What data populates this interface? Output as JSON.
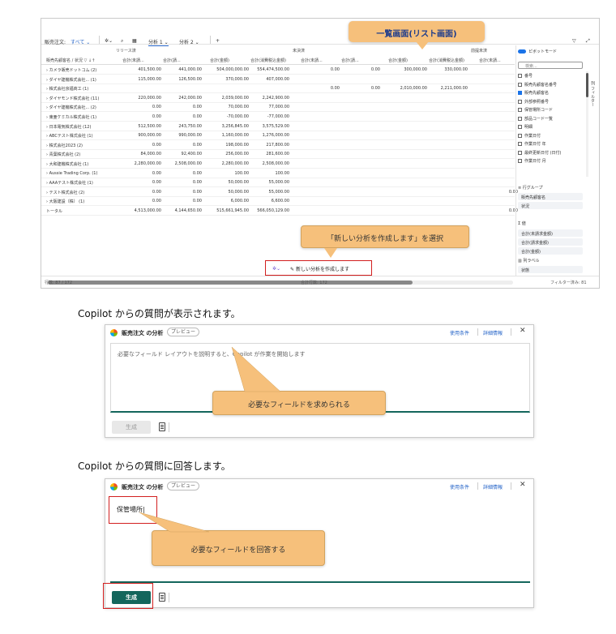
{
  "list_view": {
    "toolbar": {
      "filter_label": "販売注文:",
      "filter_value": "すべて",
      "tab1": "分析 1",
      "tab2": "分析 2",
      "add": "+"
    },
    "badge": "一覧画面(リスト画面)",
    "group_headers": [
      "リリース済",
      "未決済",
      "前提未済"
    ],
    "column_headers": [
      "販売先顧客名 / 状況",
      "合計(未請...",
      "合計(請...",
      "合計(金額)",
      "合計(消費税込金額)",
      "合計(未請...",
      "合計(請...",
      "合計(金額)",
      "合計(消費税込金額)",
      "合計(未請..."
    ],
    "rows": [
      {
        "name": "カメラ販売ドットコム (2)",
        "v": [
          "401,500.00",
          "441,000.00",
          "504,000,000.00",
          "554,474,500.00",
          "0.00",
          "0.00",
          "300,000.00",
          "330,000.00",
          ""
        ]
      },
      {
        "name": "ダイヤ建機株式会社... (1)",
        "v": [
          "115,000.00",
          "126,500.00",
          "370,000.00",
          "407,000.00",
          "",
          "",
          "",
          "",
          ""
        ]
      },
      {
        "name": "株式会社京福商工 (1)",
        "v": [
          "",
          "",
          "",
          "",
          "0.00",
          "0.00",
          "2,010,000.00",
          "2,211,000.00",
          ""
        ]
      },
      {
        "name": "ダイヤモンド株式会社 (11)",
        "v": [
          "220,000.00",
          "242,000.00",
          "2,039,000.00",
          "2,242,900.00",
          "",
          "",
          "",
          "",
          ""
        ]
      },
      {
        "name": "ダイヤ建機株式会社... (2)",
        "v": [
          "0.00",
          "0.00",
          "70,000.00",
          "77,000.00",
          "",
          "",
          "",
          "",
          ""
        ]
      },
      {
        "name": "東亜ケミカル株式会社 (1)",
        "v": [
          "0.00",
          "0.00",
          "-70,000.00",
          "-77,000.00",
          "",
          "",
          "",
          "",
          ""
        ]
      },
      {
        "name": "日本電気株式会社 (12)",
        "v": [
          "512,500.00",
          "243,750.00",
          "3,256,845.00",
          "3,575,529.00",
          "",
          "",
          "",
          "",
          ""
        ]
      },
      {
        "name": "ABCテスト株式会社 (1)",
        "v": [
          "900,000.00",
          "990,000.00",
          "1,160,000.00",
          "1,276,000.00",
          "",
          "",
          "",
          "",
          ""
        ]
      },
      {
        "name": "株式会社2023 (2)",
        "v": [
          "0.00",
          "0.00",
          "198,000.00",
          "217,800.00",
          "",
          "",
          "",
          "",
          ""
        ]
      },
      {
        "name": "青葉株式会社 (2)",
        "v": [
          "84,000.00",
          "92,400.00",
          "256,000.00",
          "281,600.00",
          "",
          "",
          "",
          "",
          ""
        ]
      },
      {
        "name": "大和建機株式会社 (1)",
        "v": [
          "2,280,000.00",
          "2,508,000.00",
          "2,280,000.00",
          "2,508,000.00",
          "",
          "",
          "",
          "",
          ""
        ]
      },
      {
        "name": "Aussie Trading Corp. (1)",
        "v": [
          "0.00",
          "0.00",
          "100.00",
          "100.00",
          "",
          "",
          "",
          "",
          ""
        ]
      },
      {
        "name": "AAAテスト株式会社 (1)",
        "v": [
          "0.00",
          "0.00",
          "50,000.00",
          "55,000.00",
          "",
          "",
          "",
          "",
          ""
        ]
      },
      {
        "name": "テスト株式会社 (2)",
        "v": [
          "0.00",
          "0.00",
          "50,000.00",
          "55,000.00",
          "",
          "",
          "",
          "",
          "0.00"
        ]
      },
      {
        "name": "大阪建設（株） (1)",
        "v": [
          "0.00",
          "0.00",
          "6,000.00",
          "6,600.00",
          "",
          "",
          "",
          "",
          ""
        ]
      },
      {
        "name": "トータル",
        "v": [
          "4,513,000.00",
          "4,144,650.00",
          "515,661,945.00",
          "566,050,129.00",
          "",
          "",
          "",
          "",
          "0.00"
        ]
      }
    ],
    "status": {
      "left": "行数: 87 / 172",
      "center": "合計行数: 172",
      "right": "フィルター済み: 81"
    },
    "panel": {
      "pivot_mode": "ピボットモード",
      "search": "検索...",
      "fields": [
        "番号",
        "販売先顧客名番号",
        "販売先顧客名",
        "外部参照番号",
        "保管場所コード",
        "部品コード一覧",
        "明細",
        "作業日付",
        "作業日付 年",
        "最終更新日付 (日付)",
        "作業日付 月"
      ],
      "row_groups_title": "行グループ",
      "row_groups": [
        "販売先顧客名",
        "状況"
      ],
      "values_title": "値",
      "values": [
        "合計(未請求金額)",
        "合計(請求金額)",
        "合計(金額)"
      ],
      "column_labels_title": "列ラベル",
      "column_labels": [
        "状態"
      ],
      "side_label": "列 フィルター"
    },
    "popup": {
      "label": "新しい分析を作成します"
    },
    "callout": "「新しい分析を作成します」を選択"
  },
  "caption1": "Copilot からの質問が表示されます。",
  "dialog1": {
    "title": "販売注文 の分析",
    "badge": "プレビュー",
    "link1": "使用条件",
    "link2": "詳細情報",
    "close": "✕",
    "placeholder": "必要なフィールド レイアウトを説明すると、Copilot が作業を開始します",
    "callout": "必要なフィールドを求められる",
    "generate": "生成"
  },
  "caption2": "Copilot からの質問に回答します。",
  "dialog2": {
    "title": "販売注文 の分析",
    "badge": "プレビュー",
    "link1": "使用条件",
    "link2": "詳細情報",
    "close": "✕",
    "input_value": "保管場所",
    "callout": "必要なフィールドを回答する",
    "generate": "生成"
  },
  "colors": {
    "accent": "#14665c",
    "callout": "#f6c07b",
    "highlight": "#d21f1f",
    "link": "#2564c8"
  }
}
